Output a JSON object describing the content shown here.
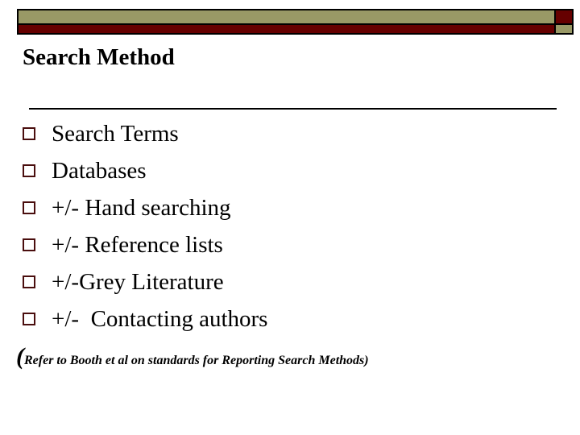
{
  "header": {
    "colors": {
      "olive": "#999966",
      "dark_red": "#660000",
      "bullet": "#4a0e0e"
    }
  },
  "slide": {
    "title": "Search Method",
    "bullets": [
      {
        "icon": "hollow-square-bullet",
        "text": "Search Terms"
      },
      {
        "icon": "hollow-square-bullet",
        "text": "Databases"
      },
      {
        "icon": "hollow-square-bullet",
        "text": "+/- Hand searching"
      },
      {
        "icon": "hollow-square-bullet",
        "text": "+/- Reference lists"
      },
      {
        "icon": "hollow-square-bullet",
        "text": "+/-Grey Literature"
      },
      {
        "icon": "hollow-square-bullet",
        "text": "+/-  Contacting authors"
      }
    ],
    "note": {
      "open_paren": "(",
      "text": "Refer to Booth et al on standards for Reporting Search Methods)"
    }
  }
}
